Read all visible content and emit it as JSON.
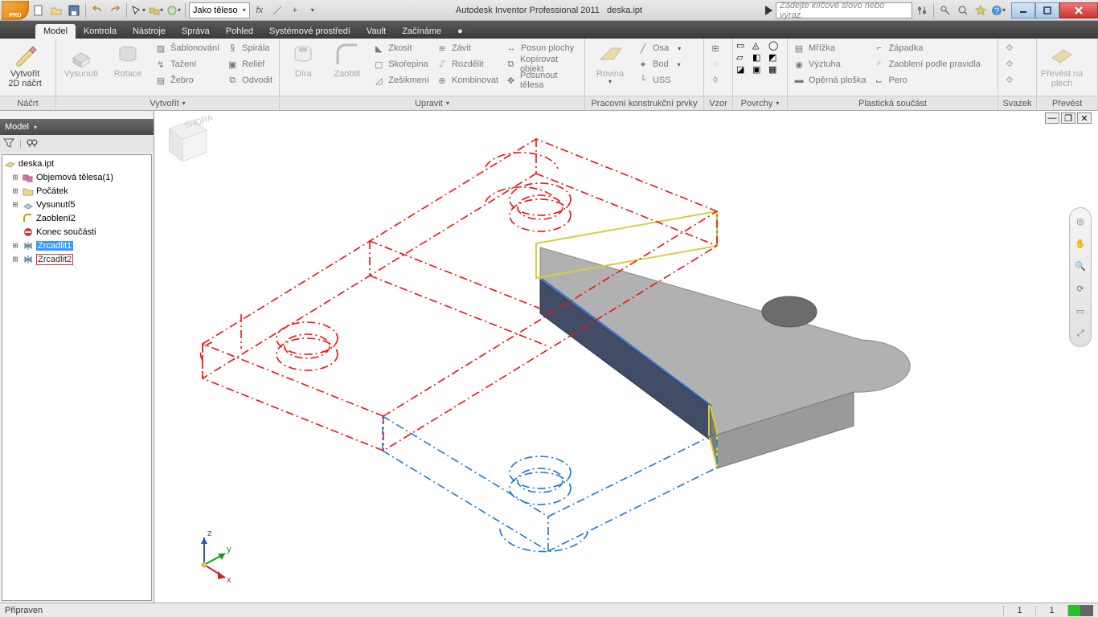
{
  "appBadge": "PRO",
  "titlebar": {
    "appTitle": "Autodesk Inventor Professional 2011",
    "docTitle": "deska.ipt",
    "combo": "Jako těleso",
    "searchPlaceholder": "Zadejte klíčové slovo nebo výraz."
  },
  "tabs": [
    "Model",
    "Kontrola",
    "Nástroje",
    "Správa",
    "Pohled",
    "Systémové prostředí",
    "Vault",
    "Začínáme"
  ],
  "activeTab": 0,
  "ribbon": {
    "sketch": {
      "title": "Náčrt",
      "create2d": "Vytvořit\n2D náčrt"
    },
    "create": {
      "title": "Vytvořit",
      "extrude": "Vysunutí",
      "revolve": "Rotace",
      "c1": [
        "Šablonování",
        "Tažení",
        "Žebro"
      ],
      "c2": [
        "Spirála",
        "Reliéf",
        "Odvodit"
      ]
    },
    "edit": {
      "title": "Upravit",
      "hole": "Díra",
      "fillet": "Zaoblit",
      "c1": [
        "Zkosit",
        "Skořepina",
        "Zešikmení"
      ],
      "c2": [
        "Závit",
        "Rozdělit",
        "Kombinovat"
      ],
      "c3": [
        "Posun plochy",
        "Kopírovat objekt",
        "Posunout tělesa"
      ]
    },
    "work": {
      "title": "Pracovní konstrukční prvky",
      "plane": "Rovina",
      "c": [
        "Osa",
        "Bod",
        "USS"
      ]
    },
    "pattern": {
      "title": "Vzor"
    },
    "surf": {
      "title": "Povrchy"
    },
    "plastic": {
      "title": "Plastická součást",
      "c1": [
        "Mřížka",
        "Výztuha",
        "Opěrná ploška"
      ],
      "c2": [
        "Západka",
        "Zaoblení podle pravidla",
        "Pero"
      ]
    },
    "harness": {
      "title": "Svazek"
    },
    "convert": {
      "title": "Převést",
      "btn": "Převést na\nplech"
    }
  },
  "browser": {
    "header": "Model",
    "root": "deska.ipt",
    "items": [
      {
        "exp": "+",
        "icon": "solids",
        "label": "Objemová tělesa(1)",
        "ind": 1
      },
      {
        "exp": "+",
        "icon": "folder",
        "label": "Počátek",
        "ind": 1
      },
      {
        "exp": "+",
        "icon": "extrude",
        "label": "Vysunutí5",
        "ind": 1
      },
      {
        "exp": "",
        "icon": "fillet",
        "label": "Zaoblení2",
        "ind": 1
      },
      {
        "exp": "",
        "icon": "eop",
        "label": "Konec součásti",
        "ind": 1
      },
      {
        "exp": "+",
        "icon": "mirror",
        "label": "Zrcadlit1",
        "ind": 1,
        "selblue": true
      },
      {
        "exp": "+",
        "icon": "mirror",
        "label": "Zrcadlit2",
        "ind": 1,
        "selred": true
      }
    ]
  },
  "status": {
    "text": "Připraven",
    "n1": "1",
    "n2": "1"
  }
}
